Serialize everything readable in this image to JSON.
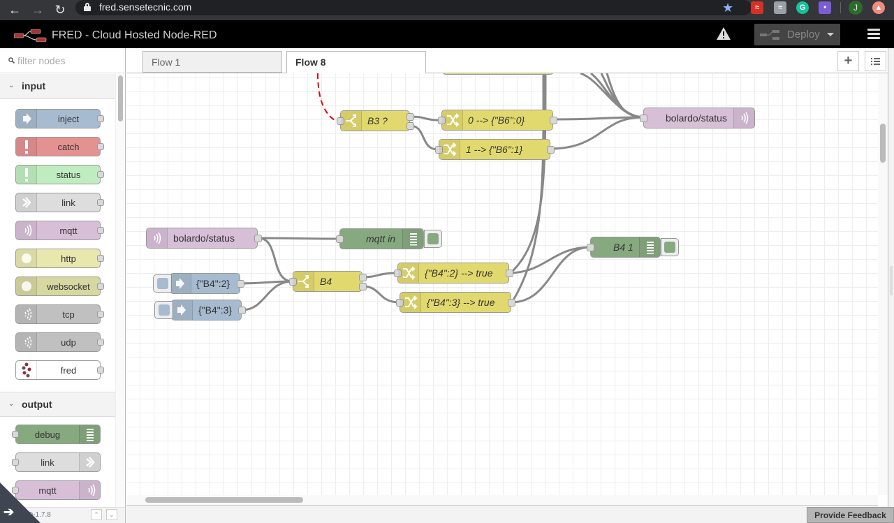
{
  "browser": {
    "url": "fred.sensetecnic.com",
    "profile_initial": "J",
    "extensions": [
      "rss-feed-red",
      "rss-feed-gray",
      "grammarly",
      "extension-purple"
    ]
  },
  "header": {
    "title": "FRED - Cloud Hosted Node-RED",
    "deploy_label": "Deploy"
  },
  "palette": {
    "filter_placeholder": "filter nodes",
    "categories": [
      {
        "label": "input",
        "nodes": [
          {
            "label": "inject",
            "color": "#a6bbcf",
            "icon": "arrow-in-icon"
          },
          {
            "label": "catch",
            "color": "#e49191",
            "icon": "alert-icon"
          },
          {
            "label": "status",
            "color": "#c0edc0",
            "icon": "alert-icon"
          },
          {
            "label": "link",
            "color": "#dddddd",
            "icon": "link-in-icon"
          },
          {
            "label": "mqtt",
            "color": "#d8bfd8",
            "icon": "bridge-icon"
          },
          {
            "label": "http",
            "color": "#e7e7ae",
            "icon": "globe-icon"
          },
          {
            "label": "websocket",
            "color": "#d7d7a0",
            "icon": "globe-icon"
          },
          {
            "label": "tcp",
            "color": "#c0c0c0",
            "icon": "bridge-icon"
          },
          {
            "label": "udp",
            "color": "#c0c0c0",
            "icon": "bridge-icon"
          },
          {
            "label": "fred",
            "color": "#ffffff",
            "icon": "fred-icon"
          }
        ]
      },
      {
        "label": "output",
        "nodes": [
          {
            "label": "debug",
            "color": "#87a980",
            "icon": "debug-icon"
          },
          {
            "label": "link",
            "color": "#dddddd",
            "icon": "link-out-icon"
          },
          {
            "label": "mqtt",
            "color": "#d8bfd8",
            "icon": "bridge-icon"
          }
        ]
      }
    ],
    "version": "FRED-1.7.8"
  },
  "tabs": [
    {
      "label": "Flow 1",
      "active": false
    },
    {
      "label": "Flow 8",
      "active": true
    }
  ],
  "flow": {
    "nodes": [
      {
        "id": "switch-b3",
        "type": "switch",
        "label": "B3 ?"
      },
      {
        "id": "change-b6-0",
        "type": "change",
        "label": "0 --> {\"B6\":0}"
      },
      {
        "id": "change-b6-1",
        "type": "change",
        "label": "1 --> {\"B6\":1}"
      },
      {
        "id": "mqtt-out-status",
        "type": "mqtt out",
        "label": "bolardo/status"
      },
      {
        "id": "mqtt-in-status",
        "type": "mqtt in",
        "label": "bolardo/status"
      },
      {
        "id": "debug-mqtt-in",
        "type": "debug",
        "label": "mqtt in"
      },
      {
        "id": "inject-b4-2",
        "type": "inject",
        "label": "{\"B4\":2}"
      },
      {
        "id": "inject-b4-3",
        "type": "inject",
        "label": "{\"B4\":3}"
      },
      {
        "id": "switch-b4",
        "type": "switch",
        "label": "B4"
      },
      {
        "id": "change-b4-2",
        "type": "change",
        "label": "{\"B4\":2} --> true"
      },
      {
        "id": "change-b4-3",
        "type": "change",
        "label": "{\"B4\":3} --> true"
      },
      {
        "id": "debug-b4-1",
        "type": "debug",
        "label": "B4 1"
      }
    ],
    "colors": {
      "switch": "#e2d96e",
      "change": "#e2d96e",
      "mqtt": "#d8bfd8",
      "debug": "#87a980",
      "inject": "#a6bbcf"
    }
  },
  "footer": {
    "feedback_label": "Provide Feedback"
  }
}
